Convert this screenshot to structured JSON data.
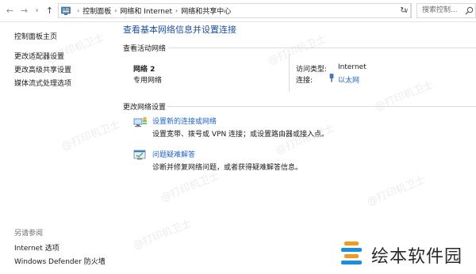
{
  "address": {
    "breadcrumbs": [
      "控制面板",
      "网络和 Internet",
      "网络和共享中心"
    ],
    "search_placeholder": "搜索控制..."
  },
  "sidebar": {
    "home": "控制面板主页",
    "links": [
      "更改适配器设置",
      "更改高级共享设置",
      "媒体流式处理选项"
    ],
    "see_also_heading": "另请参阅",
    "see_also": [
      "Internet 选项",
      "Windows Defender 防火墙"
    ]
  },
  "main": {
    "title": "查看基本网络信息并设置连接",
    "active_heading": "查看活动网络",
    "network": {
      "name": "网络 2",
      "type": "专用网络",
      "access_label": "访问类型:",
      "access_value": "Internet",
      "conn_label": "连接:",
      "conn_value": "以太网"
    },
    "change_heading": "更改网络设置",
    "tasks": [
      {
        "link": "设置新的连接或网络",
        "desc": "设置宽带、拨号或 VPN 连接；或设置路由器或接入点。"
      },
      {
        "link": "问题疑难解答",
        "desc": "诊断并修复网络问题，或者获得疑难解答信息。"
      }
    ]
  },
  "watermark": {
    "text": "@打印机卫士",
    "brand": "绘本软件园"
  },
  "colors": {
    "link": "#1e64c8",
    "title": "#1e4f9c",
    "brand_blue": "#1a8fe0",
    "brand_orange": "#f39a1e"
  }
}
